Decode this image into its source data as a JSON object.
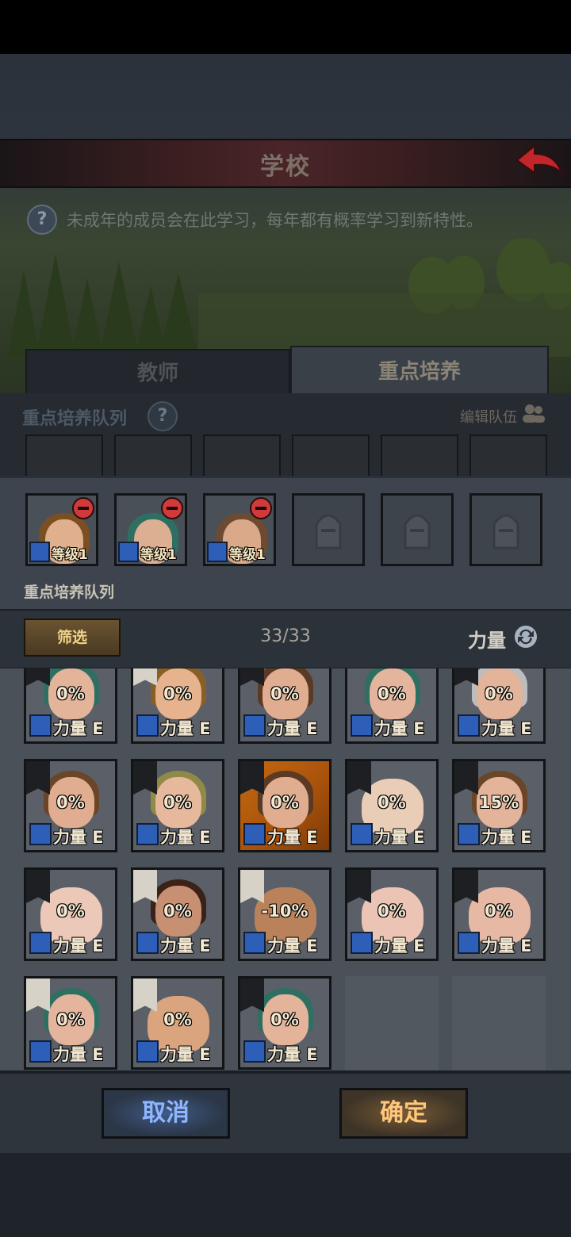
{
  "header": {
    "title": "学校",
    "info": "未成年的成员会在此学习，每年都有概率学习到新特性。"
  },
  "tabs": [
    {
      "label": "教师"
    },
    {
      "label": "重点培养"
    }
  ],
  "queue_section": {
    "label": "重点培养队列",
    "edit_label": "编辑队伍"
  },
  "selected": [
    {
      "level": "等级1",
      "hair": "#7a4f22",
      "skin": "#e0b08e"
    },
    {
      "level": "等级1",
      "hair": "#2f6f62",
      "skin": "#dcae92"
    },
    {
      "level": "等级1",
      "hair": "#6d4a30",
      "skin": "#d9a98a"
    }
  ],
  "selected_label": "重点培养队列",
  "filter": {
    "button": "筛选",
    "count": "33/33",
    "sort": "力量"
  },
  "cards": [
    {
      "pct": "0%",
      "stat": "力量 E",
      "flag": "black",
      "hair": "#2f6f62",
      "skin": "#e3b39a"
    },
    {
      "pct": "0%",
      "stat": "力量 E",
      "flag": "white",
      "hair": "#8a5f27",
      "skin": "#e6b38e"
    },
    {
      "pct": "0%",
      "stat": "力量 E",
      "flag": "black",
      "hair": "#5a3a25",
      "skin": "#e0ad90"
    },
    {
      "pct": "0%",
      "stat": "力量 E",
      "flag": "none",
      "hair": "#2f6f62",
      "skin": "#e4b49c"
    },
    {
      "pct": "0%",
      "stat": "力量 E",
      "flag": "black",
      "hair": "#bdbdbd",
      "skin": "#e3b39a"
    },
    {
      "pct": "0%",
      "stat": "力量 E",
      "flag": "black",
      "hair": "#6b4527",
      "skin": "#e0ad90"
    },
    {
      "pct": "0%",
      "stat": "力量 E",
      "flag": "black",
      "hair": "#8f8a45",
      "skin": "#e6b89c"
    },
    {
      "pct": "0%",
      "stat": "力量 E",
      "flag": "black",
      "hair": "#5a3a25",
      "skin": "#e0ad90",
      "highlight": true
    },
    {
      "pct": "0%",
      "stat": "力量 E",
      "flag": "black",
      "hair": "",
      "skin": "#e9cdb6",
      "bald": true
    },
    {
      "pct": "15%",
      "stat": "力量 E",
      "flag": "black",
      "hair": "#6b4527",
      "skin": "#e3b39a"
    },
    {
      "pct": "0%",
      "stat": "力量 E",
      "flag": "black",
      "hair": "",
      "skin": "#ecc8b8",
      "bald": true
    },
    {
      "pct": "0%",
      "stat": "力量 E",
      "flag": "white",
      "hair": "#3a2219",
      "skin": "#c79072"
    },
    {
      "pct": "-10%",
      "stat": "力量 E",
      "flag": "white",
      "hair": "",
      "skin": "#b9825a",
      "bald": true
    },
    {
      "pct": "0%",
      "stat": "力量 E",
      "flag": "black",
      "hair": "",
      "skin": "#ecc4b5",
      "bald": true
    },
    {
      "pct": "0%",
      "stat": "力量 E",
      "flag": "black",
      "hair": "",
      "skin": "#e7b9a4",
      "bald": true
    },
    {
      "pct": "0%",
      "stat": "力量 E",
      "flag": "white",
      "hair": "#2f6f62",
      "skin": "#e4b49c"
    },
    {
      "pct": "0%",
      "stat": "力量 E",
      "flag": "white",
      "hair": "",
      "skin": "#d9a47e",
      "bald": true
    },
    {
      "pct": "0%",
      "stat": "力量 E",
      "flag": "black",
      "hair": "#2f6f62",
      "skin": "#e3b39a"
    }
  ],
  "buttons": {
    "cancel": "取消",
    "confirm": "确定"
  }
}
